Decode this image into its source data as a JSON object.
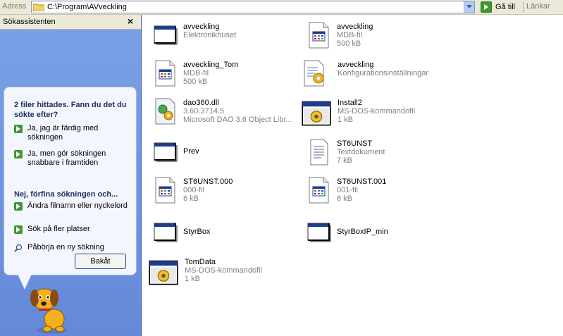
{
  "address_bar": {
    "label": "Adress",
    "path": "C:\\Program\\AVveckling",
    "goto_label": "Gå till",
    "links_label": "Länkar"
  },
  "search_pane": {
    "title": "Sökassistenten",
    "close_glyph": "×",
    "question": "2 filer hittades. Fann du det du sökte efter?",
    "options_yes": [
      {
        "label": "Ja, jag är färdig med sökningen"
      },
      {
        "label": "Ja, men gör sökningen snabbare i framtiden"
      }
    ],
    "refine_heading": "Nej, förfina sökningen och...",
    "options_refine": [
      {
        "label": "Ändra filnamn eller nyckelord"
      },
      {
        "label": "Sök på fler platser"
      }
    ],
    "new_search": "Påbörja en ny sökning",
    "back_button": "Bakåt"
  },
  "files": [
    {
      "name": "avveckling",
      "line2": "Elektronikhuset",
      "line3": "",
      "icon": "shortcut-window-icon"
    },
    {
      "name": "avveckling",
      "line2": "MDB-fil",
      "line3": "500 kB",
      "icon": "mdb-file-icon"
    },
    {
      "name": "avveckling_Tom",
      "line2": "MDB-fil",
      "line3": "500 kB",
      "icon": "mdb-file-icon"
    },
    {
      "name": "avveckling",
      "line2": "Konfigurationsinställningar",
      "line3": "",
      "icon": "config-file-icon"
    },
    {
      "name": "dao360.dll",
      "line2": "3.60.3714.5",
      "line3": "Microsoft DAO 3.6 Object Libr...",
      "icon": "dll-file-icon"
    },
    {
      "name": "Install2",
      "line2": "MS-DOS-kommandofil",
      "line3": "1 kB",
      "icon": "batch-file-icon"
    },
    {
      "name": "Prev",
      "line2": "",
      "line3": "",
      "icon": "shortcut-window-icon"
    },
    {
      "name": "ST6UNST",
      "line2": "Textdokument",
      "line3": "7 kB",
      "icon": "text-file-icon"
    },
    {
      "name": "ST6UNST.000",
      "line2": "000-fil",
      "line3": "6 kB",
      "icon": "generic-file-icon"
    },
    {
      "name": "ST6UNST.001",
      "line2": "001-fil",
      "line3": "6 kB",
      "icon": "generic-file-icon"
    },
    {
      "name": "StyrBox",
      "line2": "",
      "line3": "",
      "icon": "shortcut-window-icon"
    },
    {
      "name": "StyrBoxIP_min",
      "line2": "",
      "line3": "",
      "icon": "shortcut-window-icon"
    },
    {
      "name": "TomData",
      "line2": "MS-DOS-kommandofil",
      "line3": "1 kB",
      "icon": "batch-file-icon"
    }
  ]
}
